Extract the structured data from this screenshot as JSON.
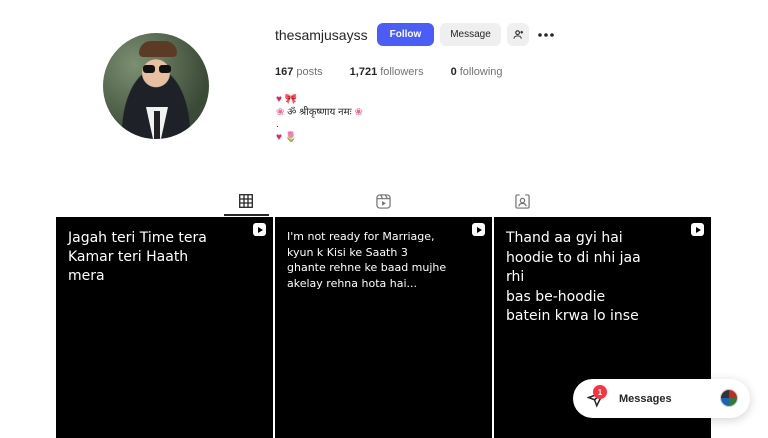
{
  "profile": {
    "username": "thesamjusayss",
    "follow_label": "Follow",
    "message_label": "Message",
    "posts_count": "167",
    "posts_label": "posts",
    "followers_count": "1,721",
    "followers_label": "followers",
    "following_count": "0",
    "following_label": "following",
    "bio_line2_text": "ॐ श्रीकृष्णाय नमः",
    "bio_line3_text": "."
  },
  "tabs": [
    {
      "icon": "grid-icon",
      "active": true
    },
    {
      "icon": "reels-icon",
      "active": false
    },
    {
      "icon": "tagged-icon",
      "active": false
    }
  ],
  "posts": [
    {
      "caption": "Jagah teri Time tera\nKamar teri Haath\nmera"
    },
    {
      "caption": "I'm not ready for Marriage,\nkyun k Kisi ke Saath 3\nghante rehne ke baad mujhe\nakelay rehna hota hai..."
    },
    {
      "caption": "Thand aa gyi hai\nhoodie to di nhi jaa\nrhi\nbas be-hoodie\nbatein krwa lo inse"
    }
  ],
  "messages": {
    "label": "Messages",
    "unread_count": "1"
  },
  "colors": {
    "follow_button": "#4a5df9",
    "badge": "#ff3040",
    "heart": "#e0245e"
  }
}
